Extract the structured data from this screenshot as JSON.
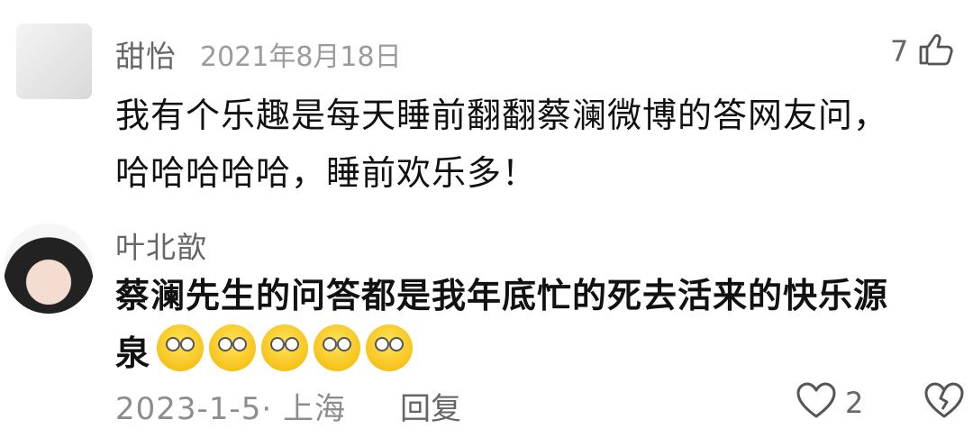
{
  "comments": [
    {
      "username": "甜怡",
      "date": "2021年8月18日",
      "text_line1": "我有个乐趣是每天睡前翻翻蔡澜微博的答网友问，",
      "text_line2": "哈哈哈哈哈，睡前欢乐多！",
      "like_count": "7"
    },
    {
      "username": "叶北歆",
      "text_line1": "蔡澜先生的问答都是我年底忙的死去活来的快乐源",
      "text_line2": "泉",
      "meta": "2023-1-5· 上海",
      "reply_label": "回复",
      "like_count": "2"
    }
  ]
}
